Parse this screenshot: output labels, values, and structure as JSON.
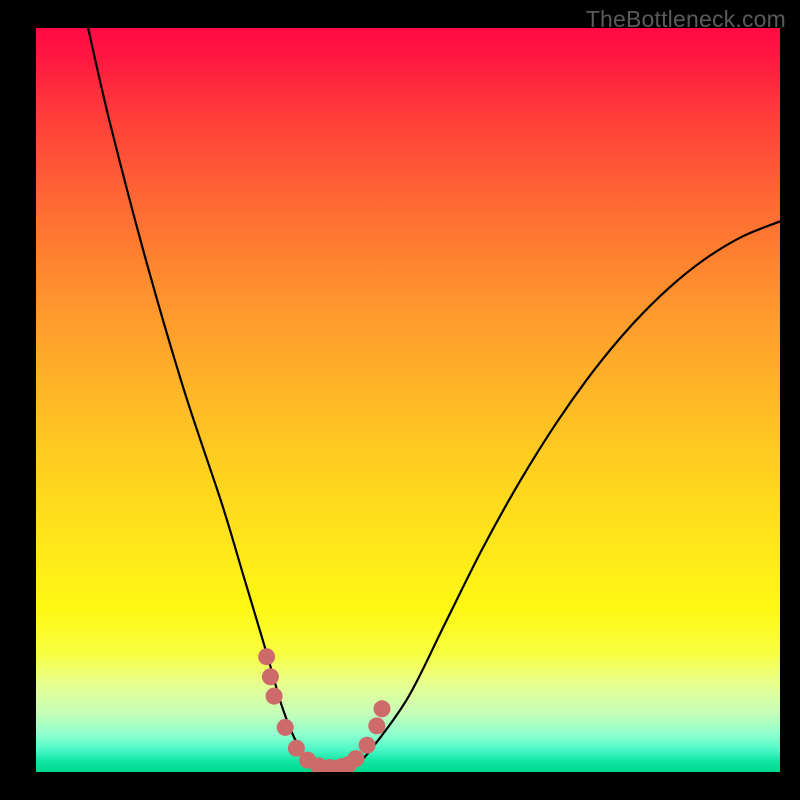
{
  "watermark": "TheBottleneck.com",
  "chart_data": {
    "type": "line",
    "title": "",
    "xlabel": "",
    "ylabel": "",
    "xlim": [
      0,
      100
    ],
    "ylim": [
      0,
      100
    ],
    "grid": false,
    "legend": false,
    "series": [
      {
        "name": "bottleneck-curve",
        "x": [
          7,
          10,
          15,
          20,
          25,
          28,
          31,
          33,
          35,
          37,
          39,
          41,
          43,
          45,
          50,
          55,
          60,
          65,
          70,
          75,
          80,
          85,
          90,
          95,
          100
        ],
        "y": [
          100,
          87,
          68,
          51,
          36,
          26,
          16,
          9,
          4,
          1,
          0,
          0,
          1,
          3,
          10,
          20,
          30,
          39,
          47,
          54,
          60,
          65,
          69,
          72,
          74
        ]
      }
    ],
    "markers": [
      {
        "name": "highlight-dots",
        "color": "#cd6a6a",
        "x": [
          31.0,
          31.5,
          32.0,
          33.5,
          35.0,
          36.5,
          38.0,
          39.5,
          41.0,
          42.0,
          43.0,
          44.5,
          45.8,
          46.5
        ],
        "y": [
          15.5,
          12.8,
          10.2,
          6.0,
          3.2,
          1.6,
          0.8,
          0.6,
          0.7,
          1.0,
          1.8,
          3.6,
          6.2,
          8.5
        ]
      }
    ],
    "gradient_bands": [
      {
        "pos": 0.0,
        "color": "#ff0a45"
      },
      {
        "pos": 0.5,
        "color": "#ffd21f"
      },
      {
        "pos": 0.85,
        "color": "#f8ff40"
      },
      {
        "pos": 1.0,
        "color": "#00d98c"
      }
    ]
  }
}
